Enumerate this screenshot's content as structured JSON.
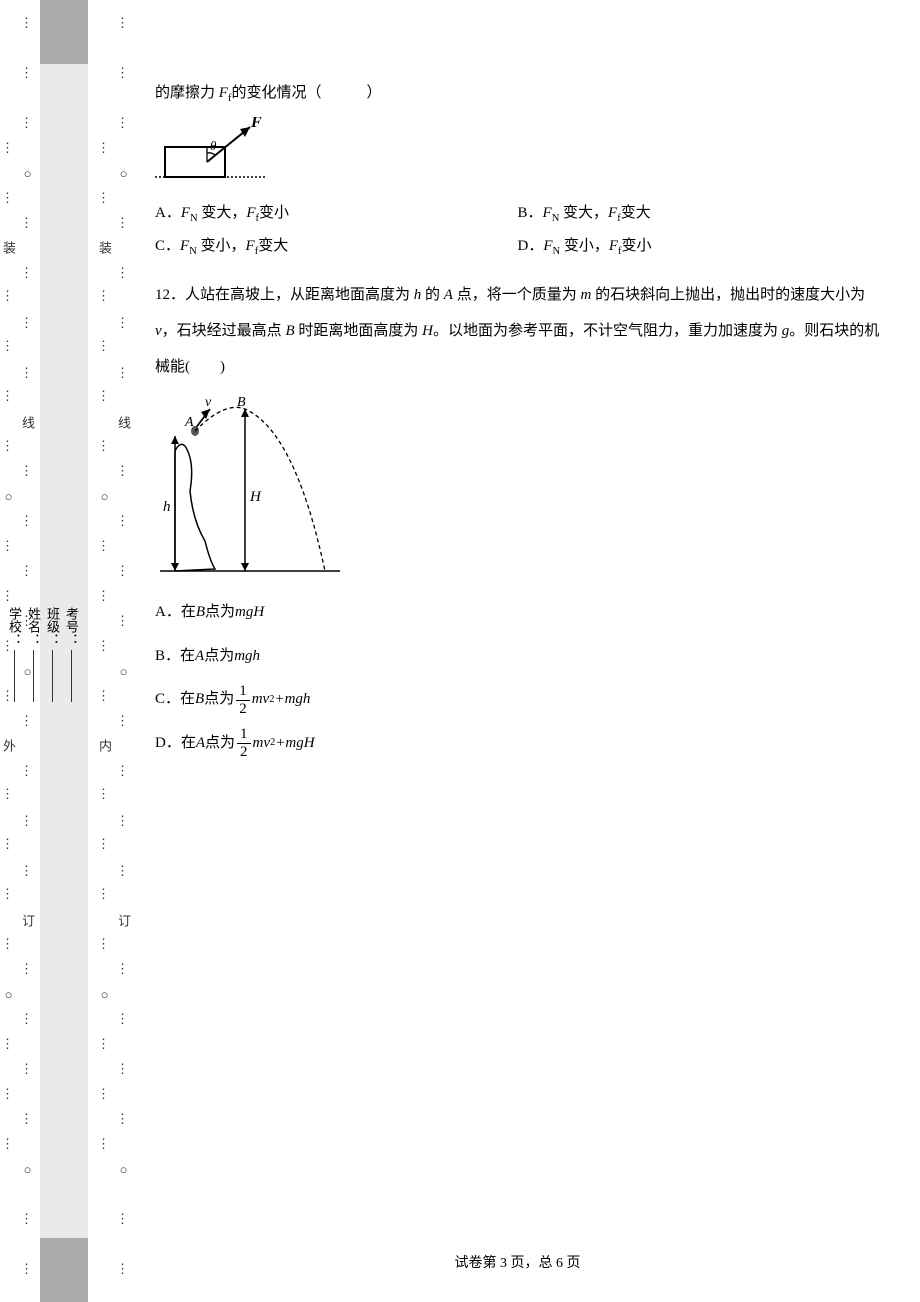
{
  "binding": {
    "outer": "⋮ ⋮ ⋮ ○ ⋮ ⋮ ⋮ ⋮ 线 ⋮ ⋮ ⋮ ⋮ ○ ⋮ ⋮ ⋮ ⋮ 订 ⋮ ⋮ ⋮ ⋮ ○ ⋮ ⋮ ⋮ ⋮ 装 ⋮ ⋮ ⋮ ⋮ ○ ⋮ ⋮ ⋮ ⋮ 外 ⋮ ⋮ ⋮ ⋮ ○ ⋮ ⋮ ⋮",
    "inner": "⋮ ⋮ ⋮ ○ ⋮ ⋮ ⋮ ⋮ 线 ⋮ ⋮ ⋮ ⋮ ○ ⋮ ⋮ ⋮ ⋮ 订 ⋮ ⋮ ⋮ ⋮ ○ ⋮ ⋮ ⋮ ⋮ 装 ⋮ ⋮ ⋮ ⋮ ○ ⋮ ⋮ ⋮ ⋮ 内 ⋮ ⋮ ⋮ ⋮ ○ ⋮ ⋮ ⋮"
  },
  "info": {
    "exam_no": "考号：",
    "class": "班级：",
    "name": "姓名：",
    "school": "学校："
  },
  "q11": {
    "lead_fragment_before": "的摩擦力 ",
    "lead_var": "F",
    "lead_sub": "f",
    "lead_fragment_after": "的变化情况（　　　）",
    "optA": {
      "label": "A．",
      "t1": "F",
      "s1": "N",
      "m1": " 变大，",
      "t2": "F",
      "s2": "f",
      "m2": "变小"
    },
    "optB": {
      "label": "B．",
      "t1": "F",
      "s1": "N",
      "m1": " 变大，",
      "t2": "F",
      "s2": "f",
      "m2": "变大"
    },
    "optC": {
      "label": "C．",
      "t1": "F",
      "s1": "N",
      "m1": " 变小，",
      "t2": "F",
      "s2": "f",
      "m2": "变大"
    },
    "optD": {
      "label": "D．",
      "t1": "F",
      "s1": "N",
      "m1": " 变小，",
      "t2": "F",
      "s2": "f",
      "m2": "变小"
    }
  },
  "q12": {
    "num": "12．",
    "line1a": "人站在高坡上，从距离地面高度为 ",
    "var_h": "h",
    "line1b": " 的 ",
    "var_A": "A",
    "line1c": " 点，将一个质量为 ",
    "var_m": "m",
    "line1d": " 的石块斜向上抛出，",
    "line2a": "抛出时的速度大小为 ",
    "var_v": "v",
    "line2b": "，石块经过最高点 ",
    "var_B": "B",
    "line2c": " 时距离地面高度为 ",
    "var_H": "H",
    "line2d": "。以地面为参考平面，",
    "line3a": "不计空气阻力，重力加速度为 ",
    "var_g": "g",
    "line3b": "。则石块的机械能(　　)",
    "optA": {
      "label": "A．",
      "pre": "在 ",
      "var": "B",
      "post": " 点为 ",
      "expr": "mgH"
    },
    "optB": {
      "label": "B．",
      "pre": "在 ",
      "var": "A",
      "post": " 点为 ",
      "expr": "mgh"
    },
    "optC": {
      "label": "C．",
      "pre": "在 ",
      "var": "B",
      "post": " 点为",
      "frac_num": "1",
      "frac_den": "2",
      "mv": "mv",
      "sup": "2",
      "plus": " + ",
      "tail": "mgh"
    },
    "optD": {
      "label": "D．",
      "pre": "在 ",
      "var": "A",
      "post": " 点为",
      "frac_num": "1",
      "frac_den": "2",
      "mv": "mv",
      "sup": "2",
      "plus": " + ",
      "tail": "mgH"
    }
  },
  "footer": {
    "text": "试卷第 3 页，总 6 页"
  }
}
